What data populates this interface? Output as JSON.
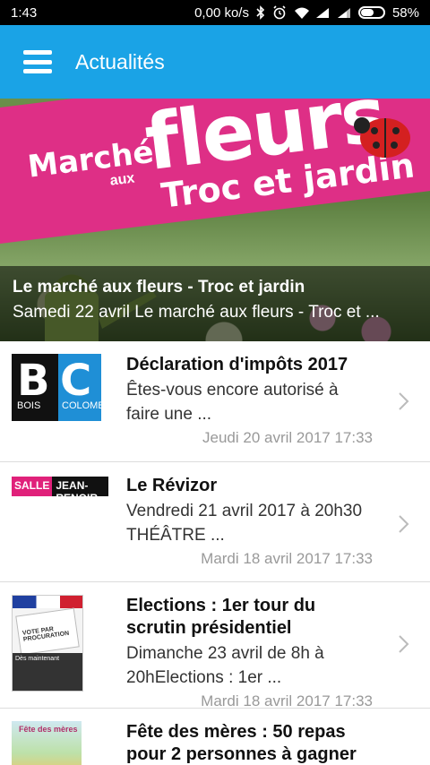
{
  "status_bar": {
    "time": "1:43",
    "network_speed": "0,00 ko/s",
    "battery_percent": "58%",
    "battery_level": 0.58,
    "icons": [
      "bluetooth-icon",
      "alarm-icon",
      "wifi-icon",
      "signal-icon",
      "signal-icon",
      "battery-icon"
    ]
  },
  "app_bar": {
    "menu_icon": "hamburger-menu-icon",
    "title": "Actualités",
    "color": "#1aa3e6"
  },
  "hero": {
    "image_text": {
      "line1": "Marché",
      "line2": "aux",
      "line3": "fleurs",
      "line4": "Troc et jardin"
    },
    "title": "Le marché aux fleurs - Troc et jardin",
    "subtitle": "Samedi 22 avril Le marché aux fleurs - Troc et ..."
  },
  "thumbnails": {
    "bc": {
      "b": "B",
      "c": "C",
      "bois": "BOIS",
      "colombes": "COLOMBES"
    },
    "salle": {
      "salle": "SALLE",
      "jean_renoir": "JEAN-RENOIR"
    },
    "vote": {
      "paper": "VOTE PAR PROCURATION",
      "banner": "Dès maintenant"
    },
    "meres": {
      "text": "Fête des mères"
    }
  },
  "news": [
    {
      "title": "Déclaration d'impôts 2017",
      "description": "Êtes-vous encore autorisé à faire une ...",
      "date": "Jeudi 20 avril 2017 17:33"
    },
    {
      "title": "Le Révizor",
      "description": "Vendredi 21 avril 2017 à 20h30  THÉÂTRE    ...",
      "date": "Mardi 18 avril 2017 17:33"
    },
    {
      "title": "Elections : 1er tour du scrutin présidentiel",
      "description": "Dimanche 23 avril de 8h à 20hElections : 1er ...",
      "date": "Mardi 18 avril 2017 17:33"
    },
    {
      "title": "Fête des mères : 50 repas pour 2 personnes à gagner",
      "description": "",
      "date": ""
    }
  ]
}
